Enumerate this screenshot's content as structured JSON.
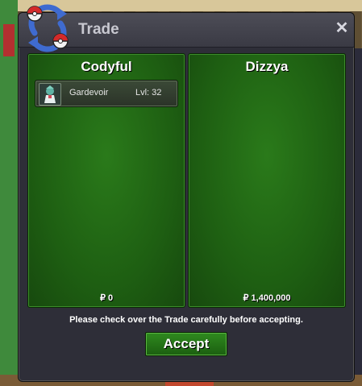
{
  "window": {
    "title": "Trade",
    "close_label": "✕"
  },
  "left_panel": {
    "player_name": "Codyful",
    "pokemon": [
      {
        "name": "Gardevoir",
        "level": "Lvl: 32"
      }
    ],
    "money_symbol": "₽",
    "money": "0"
  },
  "right_panel": {
    "player_name": "Dizzya",
    "pokemon": [],
    "money_symbol": "₽",
    "money": "1,400,000"
  },
  "notice": "Please check over the Trade carefully before accepting.",
  "accept_label": "Accept",
  "colors": {
    "panel_green": "#1e5f12",
    "dialog_bg": "#2e2e38",
    "accept_green": "#2f8a1f"
  }
}
